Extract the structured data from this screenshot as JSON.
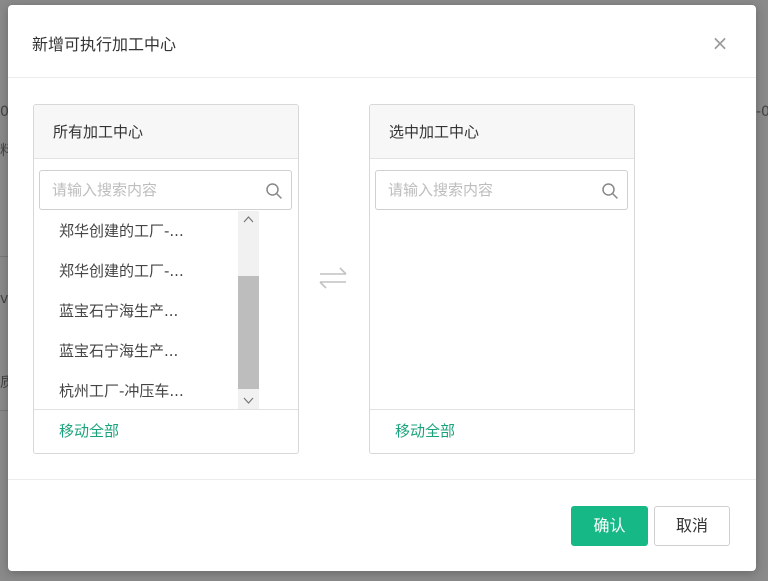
{
  "background": {
    "fragments": [
      "0",
      "料",
      "vl",
      "质",
      "-0"
    ]
  },
  "dialog": {
    "title": "新增可执行加工中心",
    "close_icon": "close-icon"
  },
  "left_panel": {
    "header": "所有加工中心",
    "search_placeholder": "请输入搜索内容",
    "items": [
      "郑华创建的工厂-...",
      "郑华创建的工厂-...",
      "蓝宝石宁海生产...",
      "蓝宝石宁海生产...",
      "杭州工厂-冲压车..."
    ],
    "move_all": "移动全部"
  },
  "right_panel": {
    "header": "选中加工中心",
    "search_placeholder": "请输入搜索内容",
    "items": [],
    "move_all": "移动全部"
  },
  "footer": {
    "confirm": "确认",
    "cancel": "取消"
  },
  "colors": {
    "accent": "#16b986",
    "link": "#1aa37a"
  }
}
